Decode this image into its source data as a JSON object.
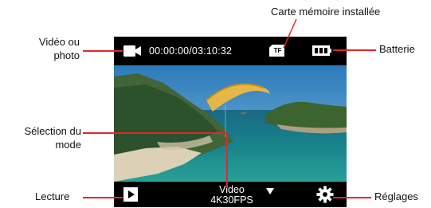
{
  "callouts": {
    "video_or_photo": [
      "Vidéo ou",
      "photo"
    ],
    "mode_selection": [
      "Sélection du",
      "mode"
    ],
    "playback": "Lecture",
    "memory_card": "Carte mémoire installée",
    "battery": "Batterie",
    "settings": "Réglages"
  },
  "screen": {
    "recording_time": "00:00:00/03:10:32",
    "memory_card_label": "TF",
    "mode_name": "Video",
    "mode_resolution": "4K30FPS"
  },
  "icons": {
    "video_mode": "video-camera-icon",
    "memory_card": "sd-card-icon",
    "battery": "battery-icon",
    "playback": "play-icon",
    "mode_dropdown": "triangle-down-icon",
    "settings": "gear-icon"
  },
  "colors": {
    "leader_line": "#e8232a",
    "screen_bars": "#000000"
  }
}
